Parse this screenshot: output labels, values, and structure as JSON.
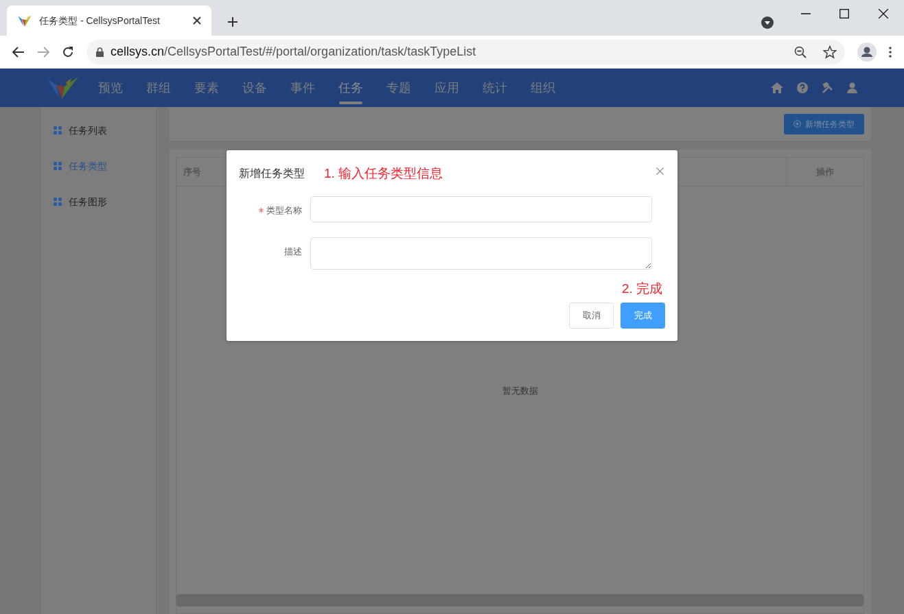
{
  "browser": {
    "tab": {
      "title": "任务类型 - CellsysPortalTest"
    },
    "address": {
      "domain": "cellsys.cn",
      "path": "/CellsysPortalTest/#/portal/organization/task/taskTypeList"
    }
  },
  "nav": {
    "items": [
      {
        "label": "预览",
        "selected": false
      },
      {
        "label": "群组",
        "selected": false
      },
      {
        "label": "要素",
        "selected": false
      },
      {
        "label": "设备",
        "selected": false
      },
      {
        "label": "事件",
        "selected": false
      },
      {
        "label": "任务",
        "selected": true
      },
      {
        "label": "专题",
        "selected": false
      },
      {
        "label": "应用",
        "selected": false
      },
      {
        "label": "统计",
        "selected": false
      },
      {
        "label": "组织",
        "selected": false
      }
    ]
  },
  "sidebar": {
    "items": [
      {
        "label": "任务列表",
        "selected": false
      },
      {
        "label": "任务类型",
        "selected": true
      },
      {
        "label": "任务图形",
        "selected": false
      }
    ]
  },
  "toolbar": {
    "add_button": "新增任务类型"
  },
  "table": {
    "columns": [
      "序号",
      "操作"
    ],
    "empty_text": "暂无数据"
  },
  "dialog": {
    "title": "新增任务类型",
    "fields": [
      {
        "kind": "input",
        "label": "类型名称",
        "required": true
      },
      {
        "kind": "textarea",
        "label": "描述",
        "required": false
      }
    ],
    "buttons": [
      {
        "label": "取消",
        "primary": false
      },
      {
        "label": "完成",
        "primary": true
      }
    ]
  },
  "annotations": [
    "1. 输入任务类型信息",
    "2. 完成"
  ]
}
